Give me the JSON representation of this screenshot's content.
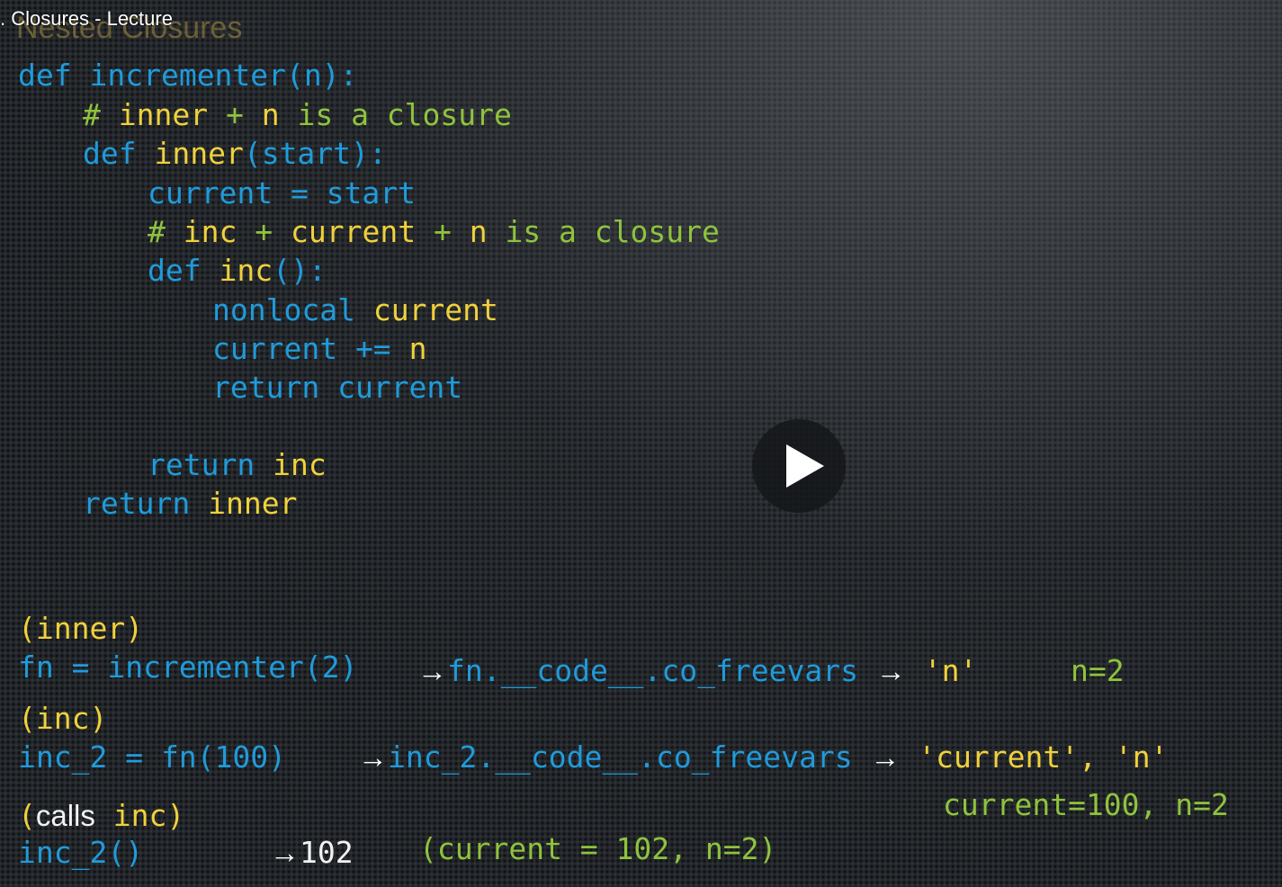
{
  "window": {
    "title": ". Closures - Lecture",
    "slide_heading": "Nested Closures"
  },
  "colors": {
    "keyword_blue": "#1f9bdb",
    "identifier_yellow": "#f0d13c",
    "comment_green": "#8fc33d",
    "plain_white": "#f2f2f2",
    "background": "#23272b"
  },
  "code": {
    "l1_kw": "def",
    "l1_name": "incrementer(n):",
    "l2_hash": "#",
    "l2_inner": "inner",
    "l2_plus": "+",
    "l2_n": "n",
    "l2_rest": "is a closure",
    "l3_kw": "def",
    "l3_inner": "inner",
    "l3_args": "(start):",
    "l4": "current = start",
    "l5_hash": "#",
    "l5_inc": "inc",
    "l5_plus1": "+",
    "l5_current": "current",
    "l5_plus2": "+",
    "l5_n": "n",
    "l5_rest": "is a closure",
    "l6_kw": "def",
    "l6_inc": "inc",
    "l6_args": "():",
    "l7_kw": "nonlocal",
    "l7_var": "current",
    "l8_expr": "current +=",
    "l8_n": "n",
    "l9": "return current",
    "l10_kw": "return",
    "l10_var": "inc",
    "l11_kw": "return",
    "l11_var": "inner"
  },
  "examples": {
    "e1_label": "(inner)",
    "e1_code": "fn = incrementer(2)",
    "e1_arrow": "→",
    "e1_attr": "fn.__code__.co_freevars",
    "e1_arrow2": "→",
    "e1_result": "'n'",
    "e1_note": "n=2",
    "e2_label": "(inc)",
    "e2_code": "inc_2 = fn(100)",
    "e2_arrow": "→",
    "e2_attr": "inc_2.__code__.co_freevars",
    "e2_arrow2": "→",
    "e2_result_a": "'current',",
    "e2_result_b": "'n'",
    "e2_note": "current=100, n=2",
    "e3_label_open": "(",
    "e3_label_calls": "calls",
    "e3_label_inc": "inc",
    "e3_label_close": ")",
    "e3_code": "inc_2()",
    "e3_arrow": "→",
    "e3_value": "102",
    "e3_note": "(current = 102, n=2)"
  },
  "player": {
    "play_icon": "play-icon"
  }
}
